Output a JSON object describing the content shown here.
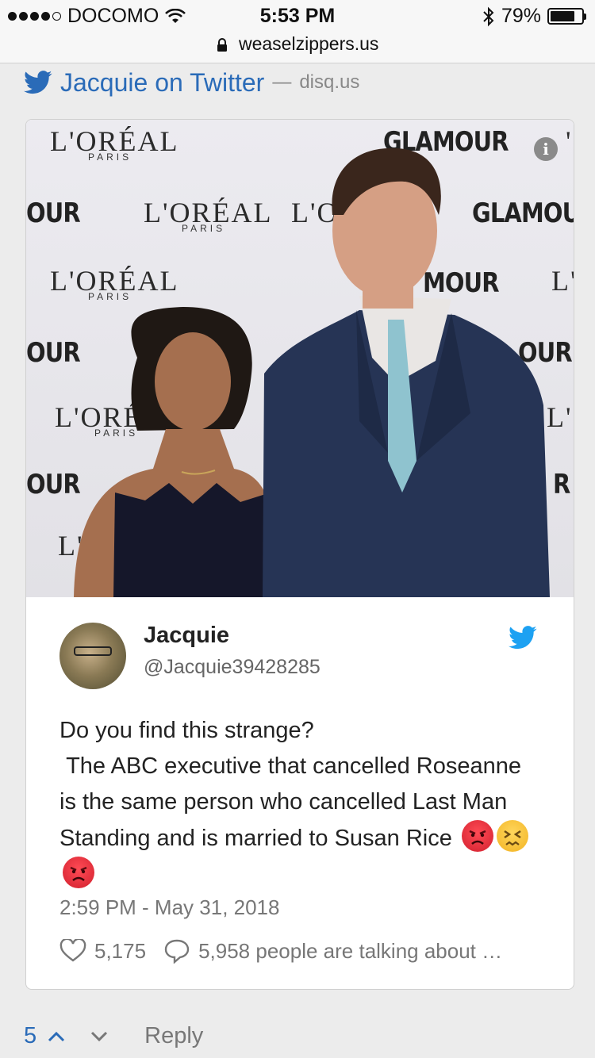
{
  "status_bar": {
    "carrier": "DOCOMO",
    "time": "5:53 PM",
    "battery": "79%",
    "battery_level": 0.79,
    "signal_bars_filled": 4,
    "signal_bars_total": 5
  },
  "url_bar": {
    "domain": "weaselzippers.us"
  },
  "link": {
    "title": "Jacquie on Twitter",
    "separator": "—",
    "domain": "disq.us"
  },
  "photo_backdrop": {
    "brand_loreal": "L'ORÉAL",
    "brand_paris": "PARIS",
    "brand_glamour": "GLAMOUR",
    "fragments": [
      "OUR",
      "L'ORÉAL",
      "L'O",
      "GLAMOU",
      "MOUR",
      "L'O",
      "OUR",
      "OUR",
      "L'ORÉ",
      "L'O",
      "OUR",
      "R",
      "L'",
      "'O"
    ]
  },
  "tweet": {
    "name": "Jacquie",
    "handle": "@Jacquie39428285",
    "text": "Do you find this strange?\n The ABC executive that cancelled Roseanne is the same person who cancelled Last Man Standing and is married to Susan Rice ",
    "timestamp": "2:59 PM - May 31, 2018",
    "likes": "5,175",
    "talking": "5,958 people are talking about …"
  },
  "footer": {
    "votes": "5",
    "reply_label": "Reply"
  },
  "colors": {
    "link_blue": "#2a6bb8",
    "twitter_blue": "#1da1f2",
    "muted_text": "#777777"
  },
  "icons": [
    "signal-icon",
    "wifi-icon",
    "bluetooth-icon",
    "battery-icon",
    "lock-icon",
    "twitter-bird-icon",
    "info-icon",
    "heart-icon",
    "speech-bubble-icon",
    "angry-face-emoji",
    "persevering-face-emoji",
    "chevron-up-icon",
    "chevron-down-icon"
  ]
}
